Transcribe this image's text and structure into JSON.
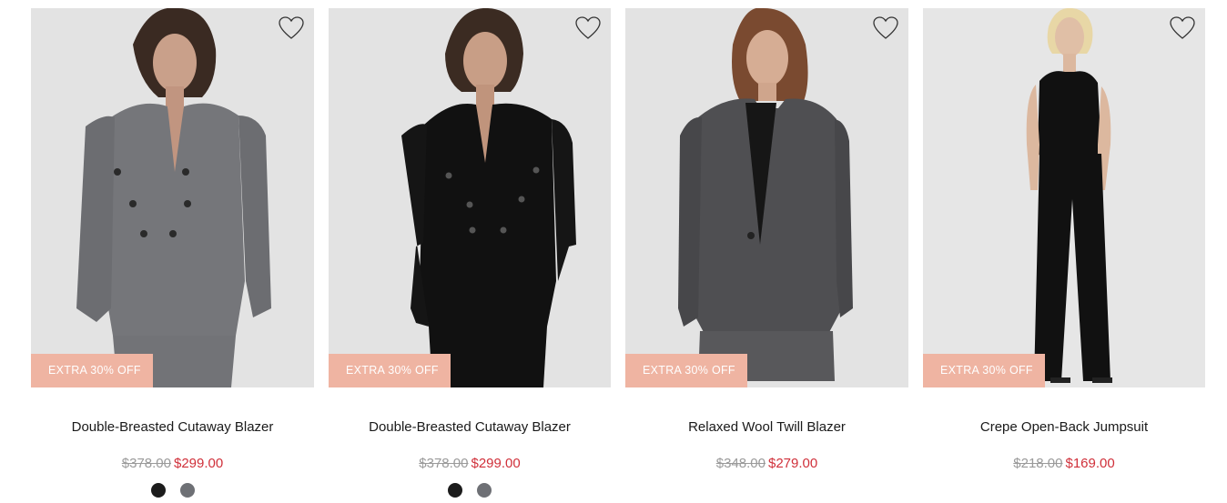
{
  "products": [
    {
      "name": "Double-Breasted Cutaway Blazer",
      "badge": "EXTRA 30% OFF",
      "original_price": "$378.00",
      "sale_price": "$299.00",
      "swatches": [
        "#1c1c1c",
        "#6e7075"
      ],
      "wishlist_icon": "heart-outline-icon"
    },
    {
      "name": "Double-Breasted Cutaway Blazer",
      "badge": "EXTRA 30% OFF",
      "original_price": "$378.00",
      "sale_price": "$299.00",
      "swatches": [
        "#1c1c1c",
        "#6e7075"
      ],
      "wishlist_icon": "heart-outline-icon"
    },
    {
      "name": "Relaxed Wool Twill Blazer",
      "badge": "EXTRA 30% OFF",
      "original_price": "$348.00",
      "sale_price": "$279.00",
      "swatches": [],
      "wishlist_icon": "heart-outline-icon"
    },
    {
      "name": "Crepe Open-Back Jumpsuit",
      "badge": "EXTRA 30% OFF",
      "original_price": "$218.00",
      "sale_price": "$169.00",
      "swatches": [],
      "wishlist_icon": "heart-outline-icon"
    }
  ],
  "colors": {
    "badge_bg": "#efb4a2",
    "sale_price": "#d0303a",
    "original_price": "#9a9a9a",
    "image_bg": "#e4e4e4"
  }
}
